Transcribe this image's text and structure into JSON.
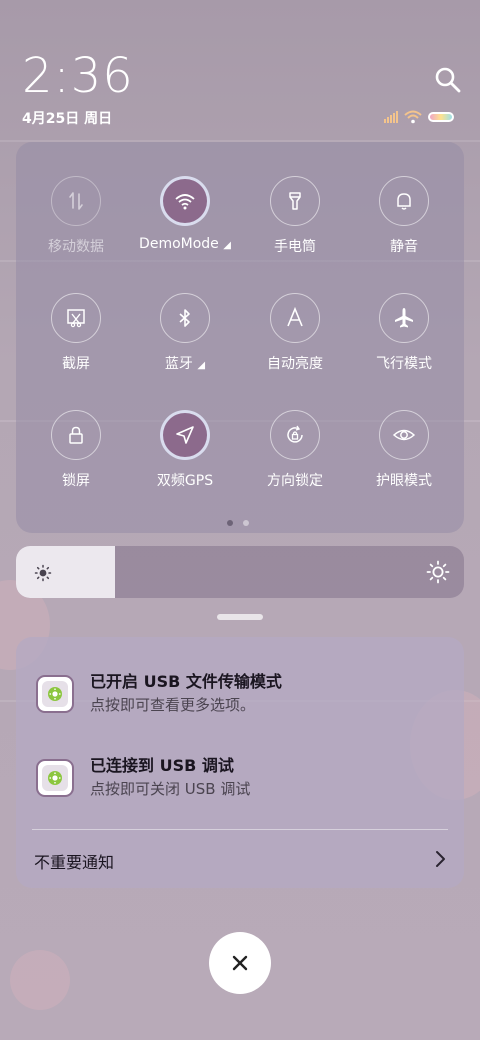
{
  "status": {
    "time": "2:36",
    "date": "4月25日 周日"
  },
  "tiles": [
    {
      "label": "移动数据",
      "icon": "mobile-data-icon",
      "active": false,
      "disabled": true
    },
    {
      "label": "DemoMode",
      "icon": "wifi-icon",
      "active": true,
      "dropdown": true
    },
    {
      "label": "手电筒",
      "icon": "flashlight-icon",
      "active": false
    },
    {
      "label": "静音",
      "icon": "bell-icon",
      "active": false
    },
    {
      "label": "截屏",
      "icon": "screenshot-icon",
      "active": false
    },
    {
      "label": "蓝牙",
      "icon": "bluetooth-icon",
      "active": false,
      "dropdown": true
    },
    {
      "label": "自动亮度",
      "icon": "auto-brightness-icon",
      "active": false
    },
    {
      "label": "飞行模式",
      "icon": "airplane-icon",
      "active": false
    },
    {
      "label": "锁屏",
      "icon": "lock-icon",
      "active": false
    },
    {
      "label": "双频GPS",
      "icon": "location-arrow-icon",
      "active": true
    },
    {
      "label": "方向锁定",
      "icon": "rotation-lock-icon",
      "active": false
    },
    {
      "label": "护眼模式",
      "icon": "eye-icon",
      "active": false
    }
  ],
  "pager": {
    "pages": 2,
    "current": 1
  },
  "brightness": {
    "level": 0.22
  },
  "notifications": [
    {
      "title": "已开启 USB 文件传输模式",
      "subtitle": "点按即可查看更多选项。",
      "icon": "android-settings-icon"
    },
    {
      "title": "已连接到 USB 调试",
      "subtitle": "点按即可关闭 USB 调试",
      "icon": "android-settings-icon"
    }
  ],
  "unimportant": {
    "label": "不重要通知"
  },
  "colors": {
    "active_tile": "#8c6a8c",
    "battery_gradient": [
      "#f0a7c5",
      "#ffe38f",
      "#9fe0e8"
    ]
  }
}
